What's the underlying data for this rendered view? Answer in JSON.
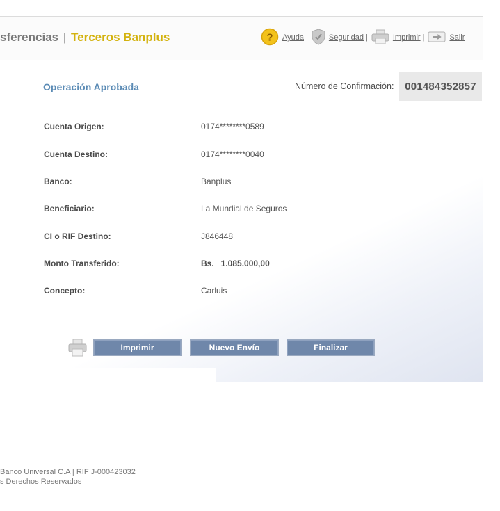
{
  "header": {
    "title_part1": "sferencias",
    "title_sep": "|",
    "title_part2": "Terceros Banplus",
    "links": {
      "help": "Ayuda",
      "security": "Seguridad",
      "print": "Imprimir",
      "exit": "Salir",
      "pipe": "|"
    }
  },
  "confirmation": {
    "status": "Operación Aprobada",
    "number_label": "Número de Confirmación:",
    "number": "001484352857"
  },
  "details": [
    {
      "label": "Cuenta Origen:",
      "value": "0174********0589"
    },
    {
      "label": "Cuenta Destino:",
      "value": "0174********0040"
    },
    {
      "label": "Banco:",
      "value": "Banplus"
    },
    {
      "label": "Beneficiario:",
      "value": "La Mundial de Seguros"
    },
    {
      "label": "CI o RIF Destino:",
      "value": "J846448"
    },
    {
      "label": "Monto Transferido:",
      "value": "Bs.   1.085.000,00"
    },
    {
      "label": "Concepto:",
      "value": "Carluis"
    }
  ],
  "buttons": {
    "print": "Imprimir",
    "new_send": "Nuevo Envío",
    "finish": "Finalizar"
  },
  "footer": {
    "line1": "Banco Universal C.A | RIF J-000423032",
    "line2": "s Derechos Reservados"
  },
  "colors": {
    "accent_blue": "#5b8bb5",
    "brand_gold": "#d3b20e",
    "button_blue": "#6f87aa"
  }
}
